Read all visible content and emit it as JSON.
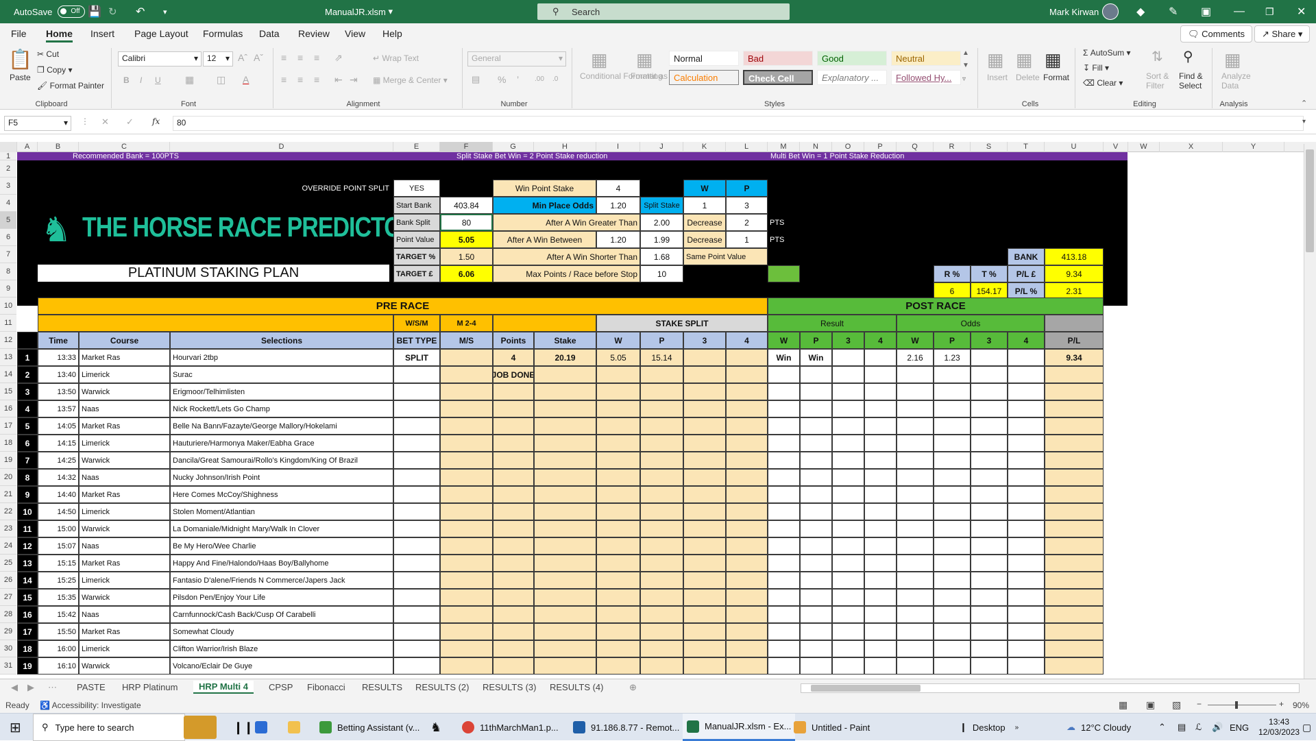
{
  "titlebar": {
    "autosave": "AutoSave",
    "autosave_state": "Off",
    "filename": "ManualJR.xlsm",
    "search": "Search",
    "user": "Mark Kirwan"
  },
  "menus": [
    "File",
    "Home",
    "Insert",
    "Page Layout",
    "Formulas",
    "Data",
    "Review",
    "View",
    "Help"
  ],
  "comments": "Comments",
  "share": "Share",
  "ribbon": {
    "clipboard": {
      "paste": "Paste",
      "cut": "Cut",
      "copy": "Copy",
      "format_painter": "Format Painter",
      "group": "Clipboard"
    },
    "font": {
      "name": "Calibri",
      "size": "12",
      "group": "Font"
    },
    "alignment": {
      "wrap": "Wrap Text",
      "merge": "Merge & Center",
      "group": "Alignment"
    },
    "number": {
      "format": "General",
      "group": "Number"
    },
    "styles": {
      "cond": "Conditional Formatting",
      "table": "Format as Table",
      "normal": "Normal",
      "bad": "Bad",
      "good": "Good",
      "neutral": "Neutral",
      "calculation": "Calculation",
      "check": "Check Cell",
      "explanatory": "Explanatory ...",
      "followed": "Followed Hy...",
      "group": "Styles"
    },
    "cells": {
      "insert": "Insert",
      "delete": "Delete",
      "format": "Format",
      "group": "Cells"
    },
    "editing": {
      "autosum": "AutoSum",
      "fill": "Fill",
      "clear": "Clear",
      "sort": "Sort & Filter",
      "find": "Find & Select",
      "group": "Editing"
    },
    "analysis": {
      "analyze": "Analyze Data",
      "group": "Analysis"
    }
  },
  "formula": {
    "namebox": "F5",
    "value": "80"
  },
  "columns": [
    "A",
    "B",
    "C",
    "D",
    "E",
    "F",
    "G",
    "H",
    "I",
    "J",
    "K",
    "L",
    "M",
    "N",
    "O",
    "P",
    "Q",
    "R",
    "S",
    "T",
    "U",
    "V",
    "W",
    "X",
    "Y"
  ],
  "rows": [
    "1",
    "2",
    "3",
    "4",
    "5",
    "6",
    "7",
    "8",
    "9",
    "10",
    "11",
    "12",
    "13",
    "14",
    "15",
    "16",
    "17",
    "18",
    "19",
    "20",
    "21",
    "22",
    "23",
    "24",
    "25",
    "26",
    "27",
    "28",
    "29",
    "30",
    "31"
  ],
  "sheet": {
    "banner1": "Recommended Bank = 100PTS",
    "banner2": "Split Stake Bet Win = 2 Point Stake reduction",
    "banner3": "Multi Bet Win = 1 Point  Stake Reduction",
    "logo": "THE HORSE RACE PREDICTOR",
    "plan": "PLATINUM STAKING PLAN",
    "override_label": "OVERRIDE POINT SPLIT",
    "override_val": "YES",
    "start_bank_l": "Start Bank",
    "start_bank": "403.84",
    "bank_split_l": "Bank Split",
    "bank_split": "80",
    "point_value_l": "Point Value",
    "point_value": "5.05",
    "target_pct_l": "TARGET %",
    "target_pct": "1.50",
    "target_gbp_l": "TARGET £",
    "target_gbp": "6.06",
    "win_point_stake_l": "Win Point Stake",
    "win_point_stake": "4",
    "min_place_odds_l": "Min Place Odds",
    "min_place_odds": "1.20",
    "after_win_greater_l": "After A Win Greater Than",
    "after_win_greater": "2.00",
    "after_win_between_l": "After A Win Between",
    "after_win_between1": "1.20",
    "after_win_between2": "1.99",
    "after_win_shorter_l": "After A Win Shorter Than",
    "after_win_shorter": "1.68",
    "max_points_l": "Max Points / Race before Stop",
    "max_points": "10",
    "split_stake": "Split Stake",
    "w": "W",
    "p": "P",
    "w_val": "1",
    "p_val": "3",
    "decrease": "Decrease",
    "dec1": "2",
    "dec2": "1",
    "pts": "PTS",
    "same_point": "Same Point Value",
    "bank_l": "BANK",
    "bank": "413.18",
    "r_pct_l": "R %",
    "t_pct_l": "T %",
    "pl_gbp_l": "P/L £",
    "pl_gbp": "9.34",
    "r_pct": "6",
    "t_pct": "154.17",
    "pl_pct_l": "P/L %",
    "pl_pct": "2.31",
    "pre_race": "PRE RACE",
    "post_race": "POST RACE",
    "wsm": "W/S/M",
    "m24": "M 2-4",
    "stake_split": "STAKE SPLIT",
    "result": "Result",
    "odds": "Odds",
    "headers": [
      "Time",
      "Course",
      "Selections",
      "BET TYPE",
      "M/S",
      "Points",
      "Stake",
      "W",
      "P",
      "3",
      "4",
      "W",
      "P",
      "3",
      "4",
      "W",
      "P",
      "3",
      "4",
      "P/L"
    ],
    "races": [
      {
        "n": "1",
        "time": "13:33",
        "course": "Market Ras",
        "sel": "Hourvari 2tbp",
        "bet": "SPLIT",
        "points": "4",
        "stake": "20.19",
        "sw": "5.05",
        "sp": "15.14",
        "rw": "Win",
        "rp": "Win",
        "ow": "2.16",
        "op": "1.23",
        "pl": "9.34"
      },
      {
        "n": "2",
        "time": "13:40",
        "course": "Limerick",
        "sel": "Surac",
        "points": "JOB DONE"
      },
      {
        "n": "3",
        "time": "13:50",
        "course": "Warwick",
        "sel": "Erigmoor/Telhimlisten"
      },
      {
        "n": "4",
        "time": "13:57",
        "course": "Naas",
        "sel": "Nick Rockett/Lets Go Champ"
      },
      {
        "n": "5",
        "time": "14:05",
        "course": "Market Ras",
        "sel": "Belle Na Bann/Fazayte/George Mallory/Hokelami"
      },
      {
        "n": "6",
        "time": "14:15",
        "course": "Limerick",
        "sel": "Hauturiere/Harmonya Maker/Eabha Grace"
      },
      {
        "n": "7",
        "time": "14:25",
        "course": "Warwick",
        "sel": "Dancila/Great Samourai/Rollo's Kingdom/King Of Brazil"
      },
      {
        "n": "8",
        "time": "14:32",
        "course": "Naas",
        "sel": "Nucky Johnson/Irish Point"
      },
      {
        "n": "9",
        "time": "14:40",
        "course": "Market Ras",
        "sel": "Here Comes McCoy/Shighness"
      },
      {
        "n": "10",
        "time": "14:50",
        "course": "Limerick",
        "sel": "Stolen Moment/Atlantian"
      },
      {
        "n": "11",
        "time": "15:00",
        "course": "Warwick",
        "sel": "La Domaniale/Midnight Mary/Walk In Clover"
      },
      {
        "n": "12",
        "time": "15:07",
        "course": "Naas",
        "sel": "Be My Hero/Wee Charlie"
      },
      {
        "n": "13",
        "time": "15:15",
        "course": "Market Ras",
        "sel": "Happy And Fine/Halondo/Haas Boy/Ballyhome"
      },
      {
        "n": "14",
        "time": "15:25",
        "course": "Limerick",
        "sel": "Fantasio D'alene/Friends N Commerce/Japers Jack"
      },
      {
        "n": "15",
        "time": "15:35",
        "course": "Warwick",
        "sel": "Pilsdon Pen/Enjoy Your Life"
      },
      {
        "n": "16",
        "time": "15:42",
        "course": "Naas",
        "sel": "Carnfunnock/Cash Back/Cusp Of Carabelli"
      },
      {
        "n": "17",
        "time": "15:50",
        "course": "Market Ras",
        "sel": "Somewhat Cloudy"
      },
      {
        "n": "18",
        "time": "16:00",
        "course": "Limerick",
        "sel": "Clifton Warrior/Irish Blaze"
      },
      {
        "n": "19",
        "time": "16:10",
        "course": "Warwick",
        "sel": "Volcano/Eclair De Guye"
      }
    ]
  },
  "sheettabs": [
    "PASTE",
    "HRP Platinum",
    "HRP Multi 4",
    "CPSP",
    "Fibonacci",
    "RESULTS",
    "RESULTS (2)",
    "RESULTS (3)",
    "RESULTS (4)"
  ],
  "status": {
    "ready": "Ready",
    "accessibility": "Accessibility: Investigate",
    "zoom": "90%"
  },
  "taskbar": {
    "search": "Type here to search",
    "betting": "Betting Assistant (v...",
    "chrome": "11thMarchMan1.p...",
    "remote": "91.186.8.77 - Remot...",
    "excel": "ManualJR.xlsm - Ex...",
    "paint": "Untitled - Paint",
    "desktop": "Desktop",
    "weather": "12°C  Cloudy",
    "lang": "ENG",
    "time": "13:43",
    "date": "12/03/2023"
  },
  "colors": {
    "excel_green": "#217346",
    "purple": "#7030a0",
    "orange": "#ffc000",
    "light_orange": "#fbe5b6",
    "post_green": "#57bb3a",
    "blue": "#00b0f0",
    "yellow": "#ffff00",
    "lightblue": "#b4c6e7"
  }
}
